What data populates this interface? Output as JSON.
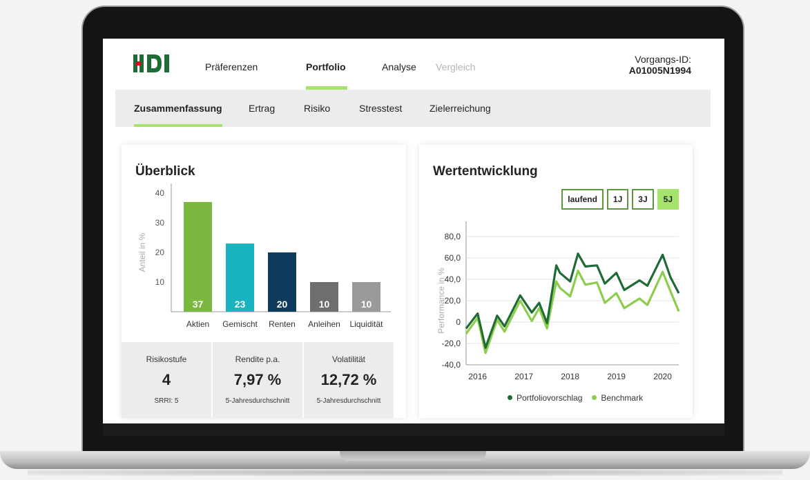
{
  "header": {
    "logo_text": "HDI",
    "nav": [
      {
        "label": "Präferenzen",
        "state": "normal"
      },
      {
        "label": "Portfolio",
        "state": "active"
      },
      {
        "label": "Analyse",
        "state": "normal"
      },
      {
        "label": "Vergleich",
        "state": "disabled"
      }
    ],
    "vorgangs_label": "Vorgangs-ID:",
    "vorgangs_id": "A01005N1994"
  },
  "subnav": [
    {
      "label": "Zusammenfassung",
      "active": true
    },
    {
      "label": "Ertrag",
      "active": false
    },
    {
      "label": "Risiko",
      "active": false
    },
    {
      "label": "Stresstest",
      "active": false
    },
    {
      "label": "Zielerreichung",
      "active": false
    }
  ],
  "overview": {
    "title": "Überblick",
    "stats": [
      {
        "label": "Risikostufe",
        "value": "4",
        "sub": "SRRI: 5"
      },
      {
        "label": "Rendite p.a.",
        "value": "7,97 %",
        "sub": "5-Jahresdurchschnitt"
      },
      {
        "label": "Volatilität",
        "value": "12,72 %",
        "sub": "5-Jahresdurchschnitt"
      }
    ]
  },
  "performance": {
    "title": "Wertentwicklung",
    "ranges": [
      {
        "label": "laufend",
        "active": false
      },
      {
        "label": "1J",
        "active": false
      },
      {
        "label": "3J",
        "active": false
      },
      {
        "label": "5J",
        "active": true
      }
    ],
    "legend": [
      {
        "label": "Portfoliovorschlag",
        "color": "#1f6b35"
      },
      {
        "label": "Benchmark",
        "color": "#8ccd4c"
      }
    ]
  },
  "chart_data": [
    {
      "type": "bar",
      "ylabel": "Anteil in %",
      "ylim": [
        0,
        40
      ],
      "yticks": [
        "10",
        "20",
        "30",
        "40"
      ],
      "categories": [
        "Aktien",
        "Gemischt",
        "Renten",
        "Anleihen",
        "Liquidität"
      ],
      "values": [
        37,
        23,
        20,
        10,
        10
      ],
      "value_labels": [
        "37",
        "23",
        "20",
        "10",
        "10"
      ],
      "colors": [
        "#7ab840",
        "#1ab4c0",
        "#0e3a5c",
        "#6e6e6e",
        "#9a9a9a"
      ]
    },
    {
      "type": "line",
      "ylabel": "Performance in %",
      "ylim": [
        -40,
        80
      ],
      "yticks": [
        "80,0",
        "60,0",
        "40,0",
        "20,0",
        "0",
        "-20,0",
        "-40,0"
      ],
      "xticks": [
        "2016",
        "2017",
        "2018",
        "2019",
        "2020"
      ],
      "xlim": [
        2015.75,
        2020.35
      ],
      "series": [
        {
          "name": "Portfoliovorschlag",
          "color": "#1f6b35",
          "x": [
            2015.75,
            2016.0,
            2016.17,
            2016.42,
            2016.58,
            2016.92,
            2017.17,
            2017.33,
            2017.5,
            2017.7,
            2017.78,
            2018.0,
            2018.17,
            2018.33,
            2018.58,
            2018.75,
            2019.0,
            2019.17,
            2019.5,
            2019.67,
            2020.0,
            2020.17,
            2020.35
          ],
          "y": [
            -6,
            8,
            -24,
            6,
            -4,
            25,
            9,
            18,
            -1,
            53,
            46,
            38,
            64,
            52,
            53,
            36,
            46,
            30,
            39,
            34,
            63,
            42,
            27
          ]
        },
        {
          "name": "Benchmark",
          "color": "#8ccd4c",
          "x": [
            2015.75,
            2016.0,
            2016.17,
            2016.42,
            2016.58,
            2016.92,
            2017.17,
            2017.33,
            2017.5,
            2017.7,
            2017.78,
            2018.0,
            2018.17,
            2018.33,
            2018.58,
            2018.75,
            2019.0,
            2019.17,
            2019.5,
            2019.67,
            2020.0,
            2020.17,
            2020.35
          ],
          "y": [
            -11,
            4,
            -29,
            2,
            -9,
            20,
            1,
            13,
            -6,
            38,
            32,
            24,
            48,
            35,
            37,
            18,
            27,
            13,
            22,
            16,
            47,
            29,
            10
          ]
        }
      ]
    }
  ]
}
